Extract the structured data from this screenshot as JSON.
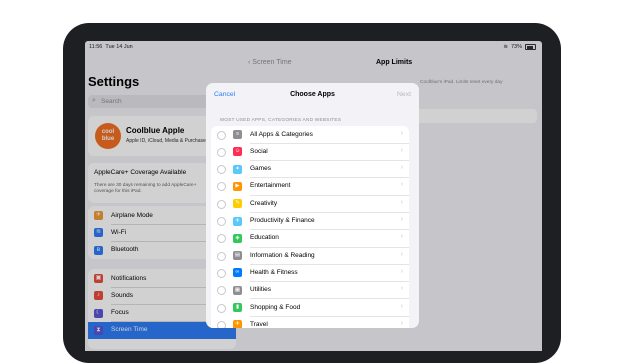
{
  "status": {
    "time": "11:56",
    "date": "Tue 14 Jun",
    "battery": "73%"
  },
  "settings": {
    "title": "Settings",
    "search_placeholder": "Search",
    "profile": {
      "avatar_line1": "cool",
      "avatar_line2": "blue",
      "name": "Coolblue Apple",
      "subtitle": "Apple ID, iCloud, Media & Purchases"
    },
    "applecare": {
      "title": "AppleCare+ Coverage Available",
      "description": "There are 30 days remaining to add AppleCare+ coverage for this iPad."
    },
    "group1": [
      {
        "label": "Airplane Mode",
        "icon": "airplane-icon",
        "color": "#f09a37",
        "glyph": "✈"
      },
      {
        "label": "Wi-Fi",
        "value": "Coolblue",
        "icon": "wifi-icon",
        "color": "#2f7cf6",
        "glyph": "≋"
      },
      {
        "label": "Bluetooth",
        "icon": "bluetooth-icon",
        "color": "#2f7cf6",
        "glyph": "ʙ"
      }
    ],
    "group2": [
      {
        "label": "Notifications",
        "icon": "notifications-icon",
        "color": "#eb4d3d",
        "glyph": "▣"
      },
      {
        "label": "Sounds",
        "icon": "sounds-icon",
        "color": "#eb4d3d",
        "glyph": "♪"
      },
      {
        "label": "Focus",
        "icon": "focus-icon",
        "color": "#5856d6",
        "glyph": "☾"
      },
      {
        "label": "Screen Time",
        "icon": "screen-time-icon",
        "color": "#5856d6",
        "glyph": "⧗",
        "selected": true
      }
    ]
  },
  "detail": {
    "back_label": "Screen Time",
    "title": "App Limits",
    "text": "Coolblue's iPad. Limits reset every day"
  },
  "modal": {
    "cancel": "Cancel",
    "title": "Choose Apps",
    "next": "Next",
    "section_header": "MOST USED APPS, CATEGORIES AND WEBSITES",
    "items": [
      {
        "label": "All Apps & Categories",
        "icon": "layers-icon",
        "color": "#8e8e93",
        "glyph": "≡"
      },
      {
        "label": "Social",
        "icon": "social-icon",
        "color": "#ff2d55",
        "glyph": "☺"
      },
      {
        "label": "Games",
        "icon": "games-icon",
        "color": "#5ac8fa",
        "glyph": "✦"
      },
      {
        "label": "Entertainment",
        "icon": "entertainment-icon",
        "color": "#ff9500",
        "glyph": "▶"
      },
      {
        "label": "Creativity",
        "icon": "creativity-icon",
        "color": "#ffcc00",
        "glyph": "✎"
      },
      {
        "label": "Productivity & Finance",
        "icon": "productivity-icon",
        "color": "#5ac8fa",
        "glyph": "✈"
      },
      {
        "label": "Education",
        "icon": "education-icon",
        "color": "#34c759",
        "glyph": "◈"
      },
      {
        "label": "Information & Reading",
        "icon": "reading-icon",
        "color": "#8e8e93",
        "glyph": "▤"
      },
      {
        "label": "Health & Fitness",
        "icon": "fitness-icon",
        "color": "#007aff",
        "glyph": "∞"
      },
      {
        "label": "Utilities",
        "icon": "utilities-icon",
        "color": "#8e8e93",
        "glyph": "▦"
      },
      {
        "label": "Shopping & Food",
        "icon": "shopping-icon",
        "color": "#34c759",
        "glyph": "▮"
      },
      {
        "label": "Travel",
        "icon": "travel-icon",
        "color": "#ff9500",
        "glyph": "✈"
      }
    ]
  }
}
